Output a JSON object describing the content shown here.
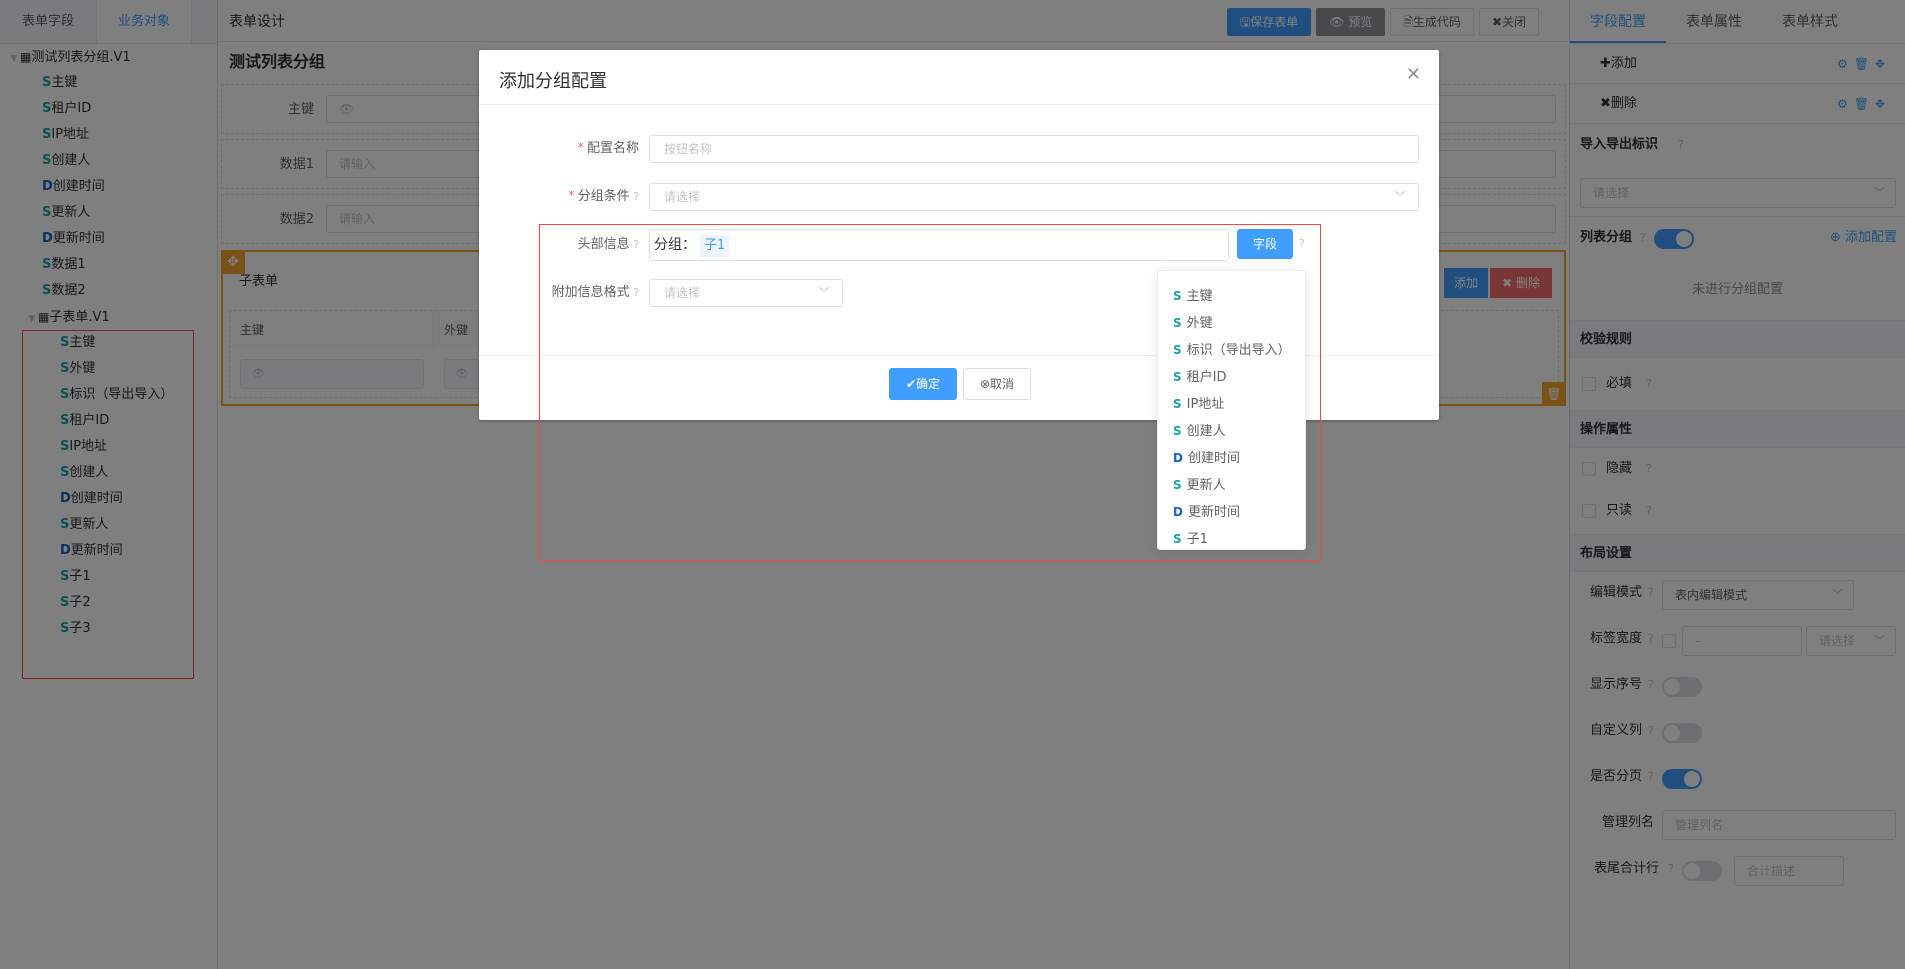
{
  "left": {
    "tabs": [
      "表单字段",
      "业务对象"
    ],
    "tree": [
      {
        "level": "lv0",
        "caret": "▼",
        "prefix": "▦",
        "type": "",
        "label": "测试列表分组.V1"
      },
      {
        "level": "lv1",
        "type": "S",
        "label": "主键"
      },
      {
        "level": "lv1",
        "type": "S",
        "label": "租户ID"
      },
      {
        "level": "lv1",
        "type": "S",
        "label": "IP地址"
      },
      {
        "level": "lv1",
        "type": "S",
        "label": "创建人"
      },
      {
        "level": "lv1",
        "type": "D",
        "label": "创建时间"
      },
      {
        "level": "lv1",
        "type": "S",
        "label": "更新人"
      },
      {
        "level": "lv1",
        "type": "D",
        "label": "更新时间"
      },
      {
        "level": "lv1",
        "type": "S",
        "label": "数据1"
      },
      {
        "level": "lv1",
        "type": "S",
        "label": "数据2"
      },
      {
        "level": "lv1b",
        "caret": "▼",
        "prefix": "▦",
        "type": "",
        "label": "子表单.V1"
      },
      {
        "level": "lv2",
        "type": "S",
        "label": "主键"
      },
      {
        "level": "lv2",
        "type": "S",
        "label": "外键"
      },
      {
        "level": "lv2",
        "type": "S",
        "label": "标识（导出导入）"
      },
      {
        "level": "lv2",
        "type": "S",
        "label": "租户ID"
      },
      {
        "level": "lv2",
        "type": "S",
        "label": "IP地址"
      },
      {
        "level": "lv2",
        "type": "S",
        "label": "创建人"
      },
      {
        "level": "lv2",
        "type": "D",
        "label": "创建时间"
      },
      {
        "level": "lv2",
        "type": "S",
        "label": "更新人"
      },
      {
        "level": "lv2",
        "type": "D",
        "label": "更新时间"
      },
      {
        "level": "lv2",
        "type": "S",
        "label": "子1"
      },
      {
        "level": "lv2",
        "type": "S",
        "label": "子2"
      },
      {
        "level": "lv2",
        "type": "S",
        "label": "子3"
      }
    ]
  },
  "center": {
    "header_title": "表单设计",
    "toolbar": {
      "save": "🖫保存表单",
      "preview": "👁 预览",
      "gen": "🗎生成代码",
      "close": "✖关闭"
    },
    "form_title": "测试列表分组",
    "rows": [
      {
        "label": "主键",
        "placeholder": "👁"
      },
      {
        "label": "数据1",
        "placeholder": "请输入"
      },
      {
        "label": "数据2",
        "placeholder": "请输入"
      }
    ],
    "subform": {
      "title": "子表单",
      "add": "添加",
      "del": "✖ 删除",
      "columns": [
        "主键",
        "外键"
      ],
      "cell_icon": "👁"
    }
  },
  "right": {
    "tabs": [
      "字段配置",
      "表单属性",
      "表单样式"
    ],
    "add": "✚添加",
    "del": "✖删除",
    "import_section": "导入导出标识",
    "import_placeholder": "请选择",
    "list_group_label": "列表分组",
    "add_group": "⊕ 添加配置",
    "no_group": "未进行分组配置",
    "validate_section": "校验规则",
    "required": "必填",
    "op_section": "操作属性",
    "hidden": "隐藏",
    "readonly": "只读",
    "layout_section": "布局设置",
    "edit_mode_label": "编辑模式",
    "edit_mode_value": "表内编辑模式",
    "label_width_label": "标签宽度",
    "label_width_sel": "请选择",
    "show_index_label": "显示序号",
    "custom_col_label": "自定义列",
    "paging_label": "是否分页",
    "manage_col_label": "管理列名",
    "manage_col_placeholder": "管理列名",
    "footer_total_label": "表尾合计行",
    "footer_total_placeholder": "合计描述"
  },
  "dialog": {
    "title": "添加分组配置",
    "config_name_label": "配置名称",
    "config_name_placeholder": "按钮名称",
    "group_cond_label": "分组条件",
    "group_cond_placeholder": "请选择",
    "header_info_label": "头部信息",
    "header_prefix": "分组：",
    "header_tag": "子1",
    "field_btn": "字段",
    "extra_label": "附加信息格式",
    "extra_placeholder": "请选择",
    "ok": "确定",
    "cancel": "取消"
  },
  "popover": [
    {
      "type": "S",
      "label": "主键"
    },
    {
      "type": "S",
      "label": "外键"
    },
    {
      "type": "S",
      "label": "标识（导出导入）"
    },
    {
      "type": "S",
      "label": "租户ID"
    },
    {
      "type": "S",
      "label": "IP地址"
    },
    {
      "type": "S",
      "label": "创建人"
    },
    {
      "type": "D",
      "label": "创建时间"
    },
    {
      "type": "S",
      "label": "更新人"
    },
    {
      "type": "D",
      "label": "更新时间"
    },
    {
      "type": "S",
      "label": "子1"
    }
  ],
  "colors": {
    "primary": "#409eff",
    "danger": "#f56c6c",
    "accent": "#f1a62a",
    "highlight": "#ff4444"
  }
}
